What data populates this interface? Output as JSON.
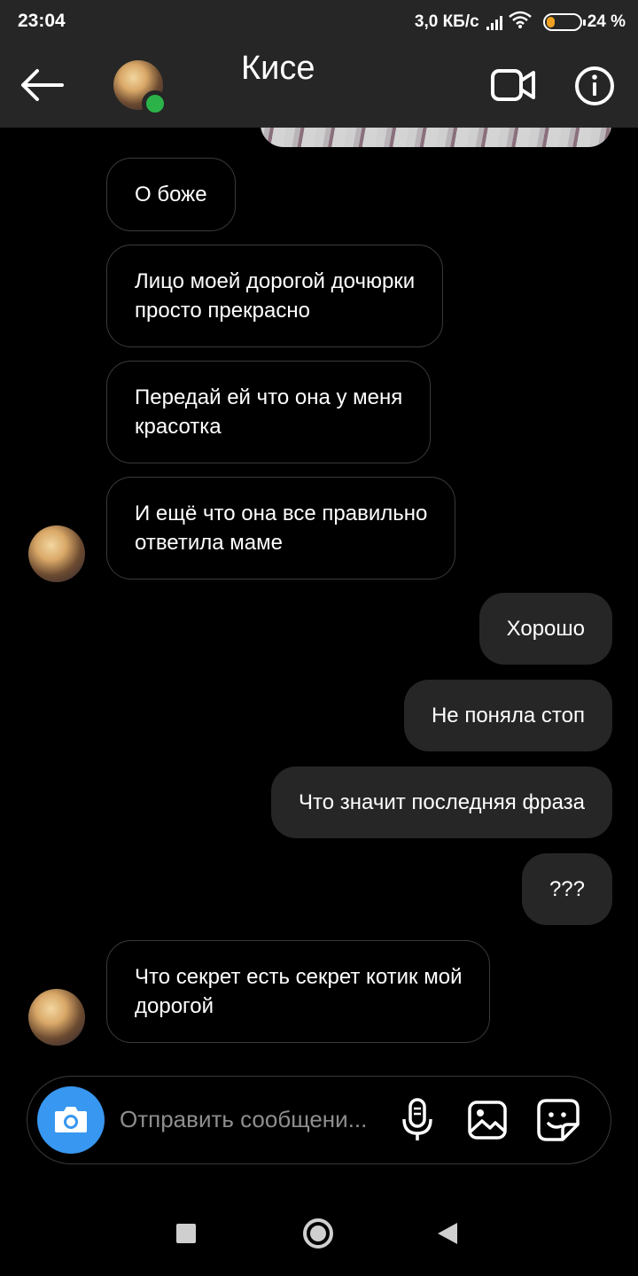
{
  "status_bar": {
    "time": "23:04",
    "network_speed": "3,0 КБ/с",
    "battery_percent": "24 %",
    "battery_level": 0.24,
    "battery_color": "#f0a020"
  },
  "header": {
    "title": "Кисе",
    "online": true,
    "online_color": "#2bb34a",
    "icons": [
      "back-arrow-icon",
      "video-camera-icon",
      "info-icon"
    ]
  },
  "messages": [
    {
      "direction": "in",
      "text": "О боже"
    },
    {
      "direction": "in",
      "text": "Лицо моей дорогой дочюрки\nпросто прекрасно"
    },
    {
      "direction": "in",
      "text": "Передай ей что она у меня\nкрасотка"
    },
    {
      "direction": "in",
      "text": "И ещё что она все правильно\nответила маме",
      "avatar": true
    },
    {
      "direction": "out",
      "text": "Хорошо"
    },
    {
      "direction": "out",
      "text": "Не поняла стоп"
    },
    {
      "direction": "out",
      "text": "Что значит последняя фраза"
    },
    {
      "direction": "out",
      "text": "???"
    },
    {
      "direction": "in",
      "text": "Что секрет есть секрет котик мой\nдорогой",
      "avatar": true
    }
  ],
  "composer": {
    "placeholder": "Отправить сообщени...",
    "accent_color": "#3897f0",
    "icons": [
      "camera-icon",
      "microphone-icon",
      "gallery-icon",
      "sticker-icon"
    ]
  },
  "nav_bar": {
    "icons": [
      "recents-square-icon",
      "home-circle-icon",
      "back-triangle-icon"
    ]
  }
}
